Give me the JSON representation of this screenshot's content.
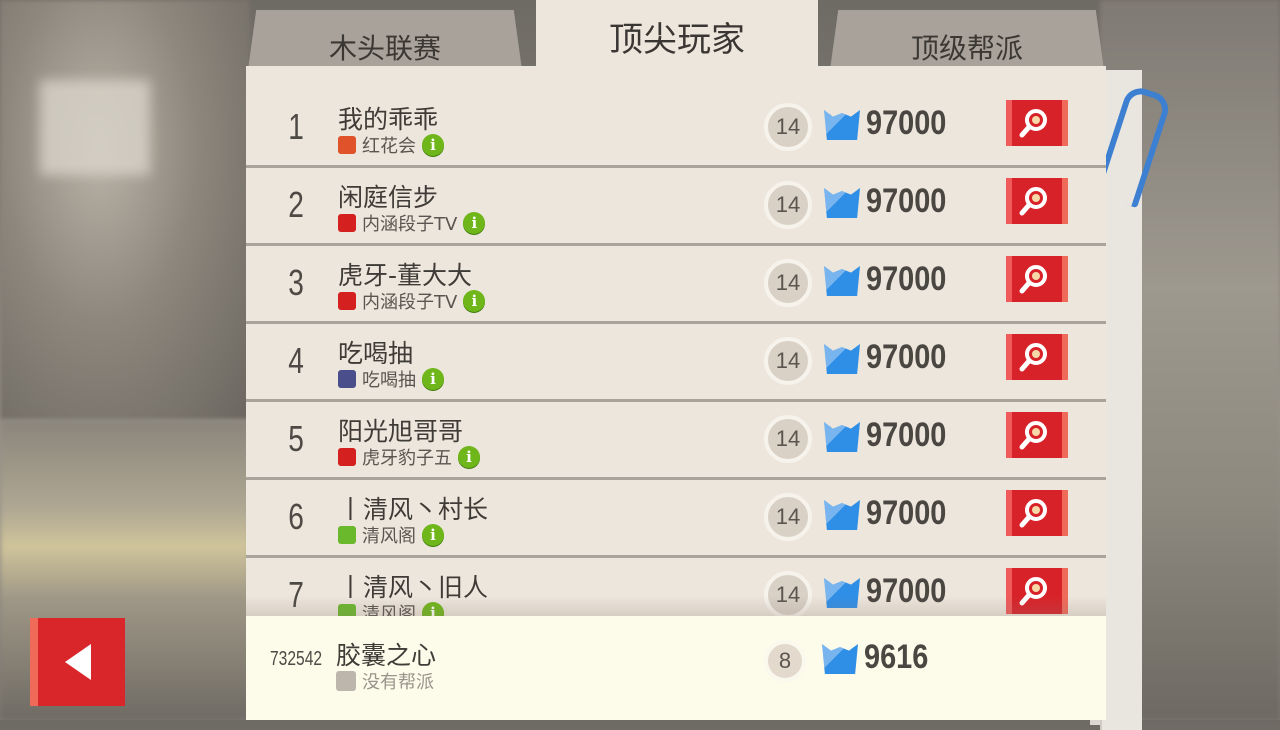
{
  "tabs": [
    {
      "label": "木头联赛",
      "active": false
    },
    {
      "label": "顶尖玩家",
      "active": true
    },
    {
      "label": "顶级帮派",
      "active": false
    }
  ],
  "rows": [
    {
      "rank": "1",
      "name": "我的乖乖",
      "clan": "红花会",
      "clan_icon_color": "#e0522a",
      "level": "14",
      "score": "97000"
    },
    {
      "rank": "2",
      "name": "闲庭信步",
      "clan": "内涵段子TV",
      "clan_icon_color": "#d4201f",
      "level": "14",
      "score": "97000"
    },
    {
      "rank": "3",
      "name": "虎牙-董大大",
      "clan": "内涵段子TV",
      "clan_icon_color": "#d4201f",
      "level": "14",
      "score": "97000"
    },
    {
      "rank": "4",
      "name": "吃喝抽",
      "clan": "吃喝抽",
      "clan_icon_color": "#4a4f8c",
      "level": "14",
      "score": "97000"
    },
    {
      "rank": "5",
      "name": "阳光旭哥哥",
      "clan": "虎牙豹子五",
      "clan_icon_color": "#d4201f",
      "level": "14",
      "score": "97000"
    },
    {
      "rank": "6",
      "name": "丨清风丶村长",
      "clan": "清风阁",
      "clan_icon_color": "#6ab82c",
      "level": "14",
      "score": "97000"
    },
    {
      "rank": "7",
      "name": "丨清风丶旧人",
      "clan": "清风阁",
      "clan_icon_color": "#6ab82c",
      "level": "14",
      "score": "97000"
    }
  ],
  "self": {
    "rank": "732542",
    "name": "胶囊之心",
    "clan": "没有帮派",
    "level": "8",
    "score": "9616"
  },
  "colors": {
    "accent_red": "#d8222a",
    "trophy_blue": "#2f8ee6",
    "info_green": "#6eb61a"
  },
  "icons": {
    "info": "info-icon",
    "view": "magnifier-icon",
    "trophy": "trophy-icon",
    "back": "back-arrow-icon"
  }
}
